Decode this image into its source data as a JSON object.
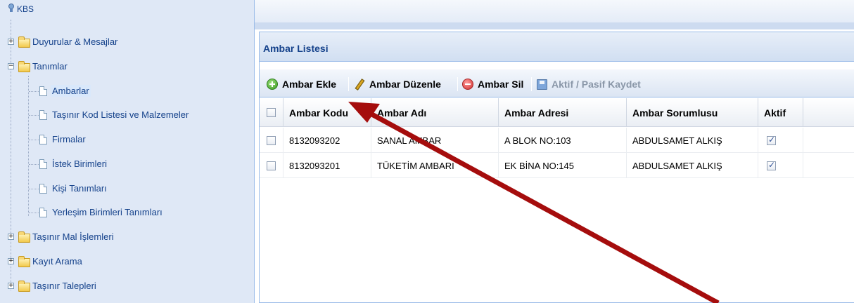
{
  "app": {
    "title": "KBS"
  },
  "tree": [
    {
      "label": "Duyurular & Mesajlar",
      "type": "folder",
      "expander": "+"
    },
    {
      "label": "Tanımlar",
      "type": "folder",
      "expander": "−"
    },
    {
      "label": "Ambarlar",
      "type": "leaf",
      "selected": true
    },
    {
      "label": "Taşınır Kod Listesi ve Malzemeler",
      "type": "leaf"
    },
    {
      "label": "Firmalar",
      "type": "leaf"
    },
    {
      "label": "İstek Birimleri",
      "type": "leaf"
    },
    {
      "label": "Kişi Tanımları",
      "type": "leaf"
    },
    {
      "label": "Yerleşim Birimleri Tanımları",
      "type": "leaf"
    },
    {
      "label": "Taşınır Mal İşlemleri",
      "type": "folder",
      "expander": "+"
    },
    {
      "label": "Kayıt Arama",
      "type": "folder",
      "expander": "+"
    },
    {
      "label": "Taşınır Talepleri",
      "type": "folder",
      "expander": "+"
    }
  ],
  "panel": {
    "title": "Ambar Listesi"
  },
  "toolbar": {
    "add_label": "Ambar Ekle",
    "edit_label": "Ambar Düzenle",
    "delete_label": "Ambar Sil",
    "save_label": "Aktif / Pasif Kaydet"
  },
  "grid": {
    "columns": [
      "Ambar Kodu",
      "Ambar Adı",
      "Ambar Adresi",
      "Ambar Sorumlusu",
      "Aktif"
    ],
    "rows": [
      {
        "code": "8132093202",
        "name": "SANAL AMBAR",
        "address": "A BLOK NO:103",
        "owner": "ABDULSAMET ALKIŞ",
        "active": true
      },
      {
        "code": "8132093201",
        "name": "TÜKETİM AMBARI",
        "address": "EK BİNA NO:145",
        "owner": "ABDULSAMET ALKIŞ",
        "active": true
      }
    ]
  },
  "colors": {
    "annotation_arrow": "#a50d0d",
    "tree_bg": "#dfe8f6",
    "accent": "#15428b"
  }
}
